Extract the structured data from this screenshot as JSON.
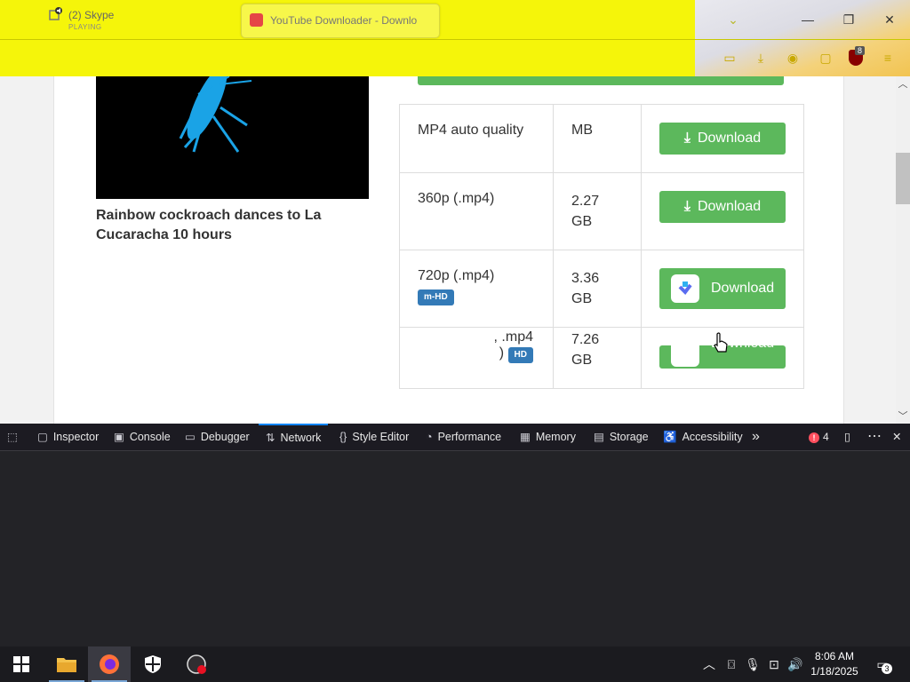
{
  "browser": {
    "skype_tab": {
      "title": "(2) Skype",
      "subtitle": "PLAYING"
    },
    "active_tab": {
      "title": "YouTube Downloader - Downlo"
    },
    "toolbar_badge": "8"
  },
  "page": {
    "video_title": "Rainbow cockroach dances to La Cucaracha 10 hours",
    "download_label": "Download",
    "rows": [
      {
        "format": "MP4 auto quality",
        "size": "MB",
        "badge": ""
      },
      {
        "format": "360p (.mp4)",
        "size": "2.27 GB",
        "badge": ""
      },
      {
        "format": "720p (.mp4)",
        "size": "3.36 GB",
        "badge": "m-HD"
      },
      {
        "format": ", .mp4",
        "format2": ")",
        "size": "7.26 GB",
        "badge": "HD"
      }
    ],
    "accent_color": "#5cb85c"
  },
  "devtools": {
    "tabs": [
      "Inspector",
      "Console",
      "Debugger",
      "Network",
      "Style Editor",
      "Performance",
      "Memory",
      "Storage",
      "Accessibility"
    ],
    "active_tab": "Network",
    "error_count": "4"
  },
  "taskbar": {
    "time": "8:06 AM",
    "date": "1/18/2025",
    "notifications": "3"
  }
}
